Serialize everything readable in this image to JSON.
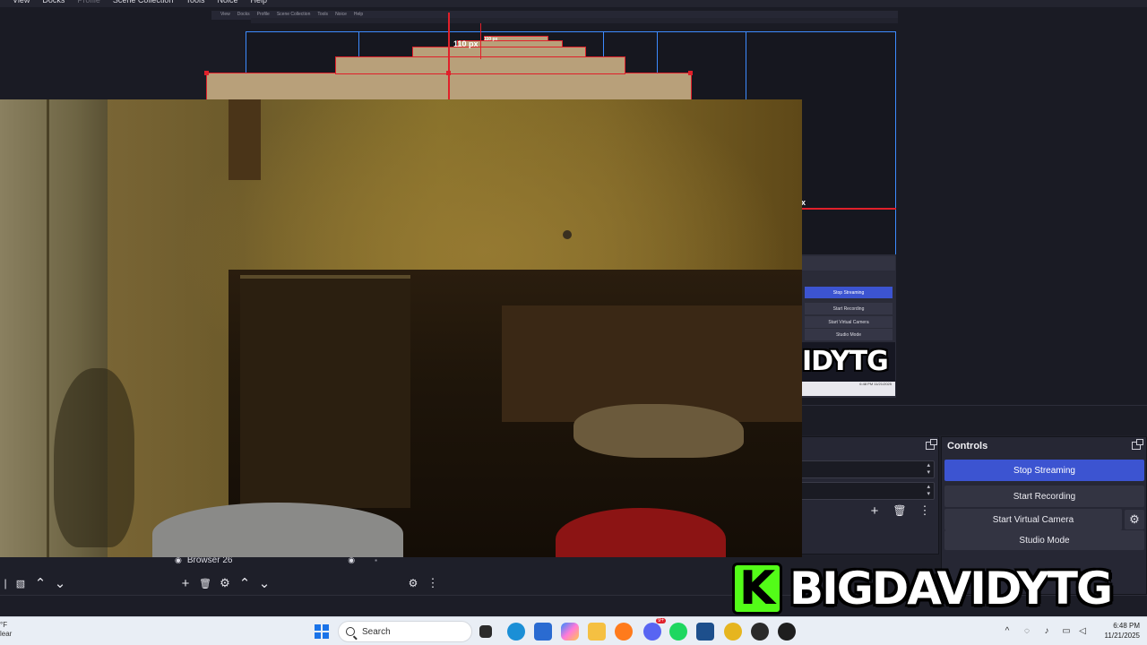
{
  "menubar": {
    "items": [
      "View",
      "Docks",
      "Profile",
      "Scene Collection",
      "Tools",
      "Noice",
      "Help"
    ]
  },
  "preview": {
    "mini_menu_items": [
      "View",
      "Docks",
      "Profile",
      "Scene Collection",
      "Tools",
      "Noice",
      "Help"
    ],
    "px_label_main": "110 px",
    "px_label_small": "110 px",
    "px_label_right": "x",
    "mini_controls": {
      "stop_streaming": "Stop Streaming",
      "start_recording": "Start Recording",
      "start_virtual_camera": "Start Virtual Camera",
      "studio_mode": "Studio Mode"
    },
    "mini_brand": "IDYTG",
    "mini_clock": "6:48 PM 11/21/2025"
  },
  "controls": {
    "title": "Controls",
    "stop_streaming": "Stop Streaming",
    "start_recording": "Start Recording",
    "start_virtual_camera": "Start Virtual Camera",
    "studio_mode": "Studio Mode"
  },
  "sources": {
    "row_label": "Browser 26"
  },
  "brand": {
    "logo_letter": "K",
    "name": "BIGDAVIDYTG",
    "accent": "#53fc18"
  },
  "taskbar": {
    "weather_temp": "°F",
    "weather_desc": "lear",
    "search_placeholder": "Search",
    "time": "6:48 PM",
    "date": "11/21/2025",
    "discord_badge": "9+"
  },
  "colors": {
    "stream_button": "#3c54d1",
    "selection_red": "#e0202a",
    "bounding_blue": "#3d8bff"
  }
}
